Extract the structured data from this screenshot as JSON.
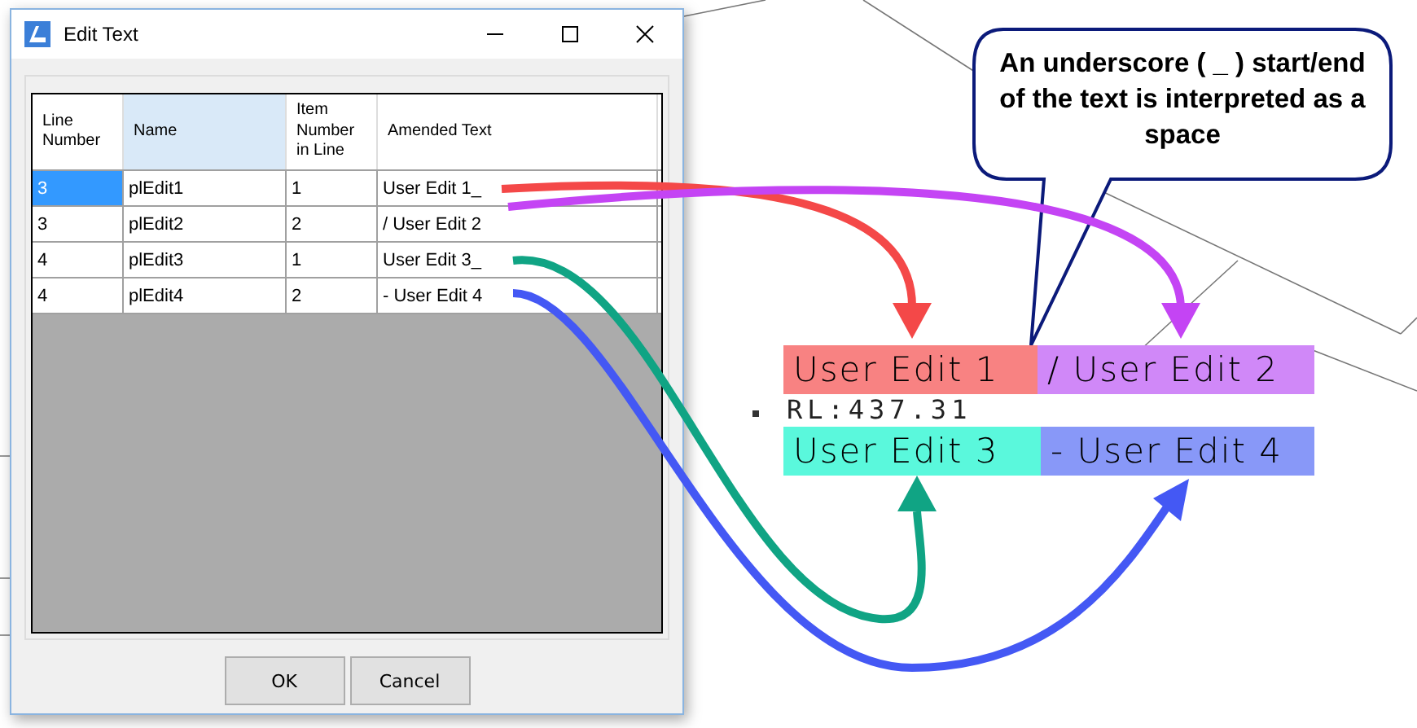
{
  "window": {
    "title": "Edit Text"
  },
  "table": {
    "columns": [
      {
        "label": "Line Number",
        "selected": false
      },
      {
        "label": "Name",
        "selected": true
      },
      {
        "label": "Item Number in Line",
        "selected": false
      },
      {
        "label": "Amended Text",
        "selected": false
      }
    ],
    "rows": [
      {
        "cells": [
          "3",
          "plEdit1",
          "1",
          "User Edit 1_"
        ],
        "selected": true
      },
      {
        "cells": [
          "3",
          "plEdit2",
          "2",
          "/ User Edit 2"
        ],
        "selected": false
      },
      {
        "cells": [
          "4",
          "plEdit3",
          "1",
          "User Edit 3_"
        ],
        "selected": false
      },
      {
        "cells": [
          "4",
          "plEdit4",
          "2",
          "- User Edit 4"
        ],
        "selected": false
      }
    ]
  },
  "buttons": [
    "OK",
    "Cancel"
  ],
  "callout": {
    "text": "An underscore ( _ ) start/end of the text is interpreted as a space"
  },
  "drawing": {
    "level_text": "RL:437.31",
    "labels": [
      {
        "text": "User Edit 1",
        "color": "#f88282"
      },
      {
        "text": "/ User Edit 2",
        "color": "#d088f8"
      },
      {
        "text": "User Edit 3",
        "color": "#5af8dc"
      },
      {
        "text": "- User Edit 4",
        "color": "#8898f8"
      }
    ],
    "arrows": [
      {
        "color": "#f44848"
      },
      {
        "color": "#c444f4"
      },
      {
        "color": "#10a484"
      },
      {
        "color": "#4458f4"
      }
    ]
  }
}
